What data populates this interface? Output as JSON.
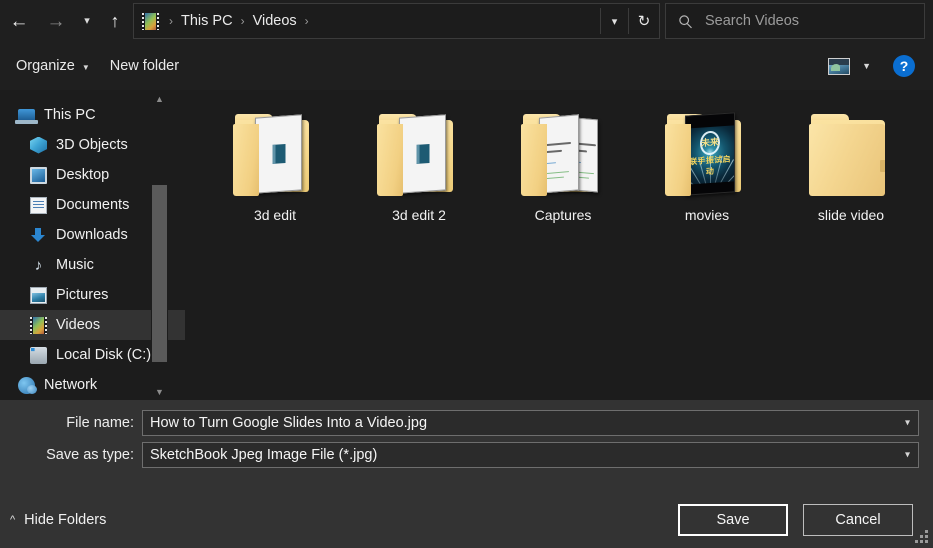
{
  "nav": {
    "back_icon": "arrow-left-icon",
    "forward_icon": "arrow-right-icon",
    "history_icon": "chevron-down-icon",
    "up_icon": "arrow-up-icon",
    "breadcrumb": {
      "location_icon": "videos-folder-icon",
      "items": [
        "This PC",
        "Videos"
      ],
      "separator": "›",
      "trailing_separator": "›"
    },
    "address_dropdown_icon": "chevron-down-icon",
    "refresh_icon": "refresh-icon",
    "refresh_glyph": "↻"
  },
  "search": {
    "icon": "search-icon",
    "placeholder": "Search Videos",
    "value": ""
  },
  "toolbar": {
    "organize_label": "Organize",
    "organize_caret": "▼",
    "new_folder_label": "New folder",
    "view_icon": "view-layout-icon",
    "view_caret": "▼",
    "help_icon": "help-icon",
    "help_label": "?"
  },
  "sidebar": {
    "scroll_up_icon": "chevron-up-icon",
    "scroll_down_icon": "chevron-down-icon",
    "items": [
      {
        "label": "This PC",
        "icon": "this-pc-icon",
        "level": "root",
        "selected": false
      },
      {
        "label": "3D Objects",
        "icon": "3d-objects-icon",
        "level": "child",
        "selected": false
      },
      {
        "label": "Desktop",
        "icon": "desktop-icon",
        "level": "child",
        "selected": false
      },
      {
        "label": "Documents",
        "icon": "documents-icon",
        "level": "child",
        "selected": false
      },
      {
        "label": "Downloads",
        "icon": "downloads-icon",
        "level": "child",
        "selected": false
      },
      {
        "label": "Music",
        "icon": "music-icon",
        "level": "child",
        "selected": false
      },
      {
        "label": "Pictures",
        "icon": "pictures-icon",
        "level": "child",
        "selected": false
      },
      {
        "label": "Videos",
        "icon": "videos-icon",
        "level": "child",
        "selected": true
      },
      {
        "label": "Local Disk (C:)",
        "icon": "local-disk-icon",
        "level": "child",
        "selected": false
      },
      {
        "label": "Network",
        "icon": "network-icon",
        "level": "root",
        "selected": false
      }
    ]
  },
  "files": {
    "items": [
      {
        "name": "3d edit",
        "type": "folder",
        "thumbnail": "document-preview"
      },
      {
        "name": "3d edit 2",
        "type": "folder",
        "thumbnail": "document-preview"
      },
      {
        "name": "Captures",
        "type": "folder",
        "thumbnail": "two-document-preview"
      },
      {
        "name": "movies",
        "type": "folder",
        "thumbnail": "video-preview"
      },
      {
        "name": "slide video",
        "type": "folder",
        "thumbnail": "empty"
      }
    ]
  },
  "form": {
    "filename_label": "File name:",
    "filename_value": "How to Turn Google Slides Into a Video.jpg",
    "filetype_label": "Save as type:",
    "filetype_value": "SketchBook Jpeg Image File (*.jpg)",
    "dropdown_icon": "chevron-down-icon"
  },
  "footer": {
    "hide_folders_label": "Hide Folders",
    "hide_folders_caret": "˄",
    "save_label": "Save",
    "cancel_label": "Cancel",
    "resize_grip_icon": "resize-grip-icon"
  },
  "colors": {
    "window_bg": "#1f1f1f",
    "browser_bg": "#1c1c1c",
    "form_bg": "#333333",
    "accent_blue": "#0a6ed1",
    "folder_yellow": "#f5d78c",
    "selection": "#333333",
    "text": "#f0f0f0"
  }
}
